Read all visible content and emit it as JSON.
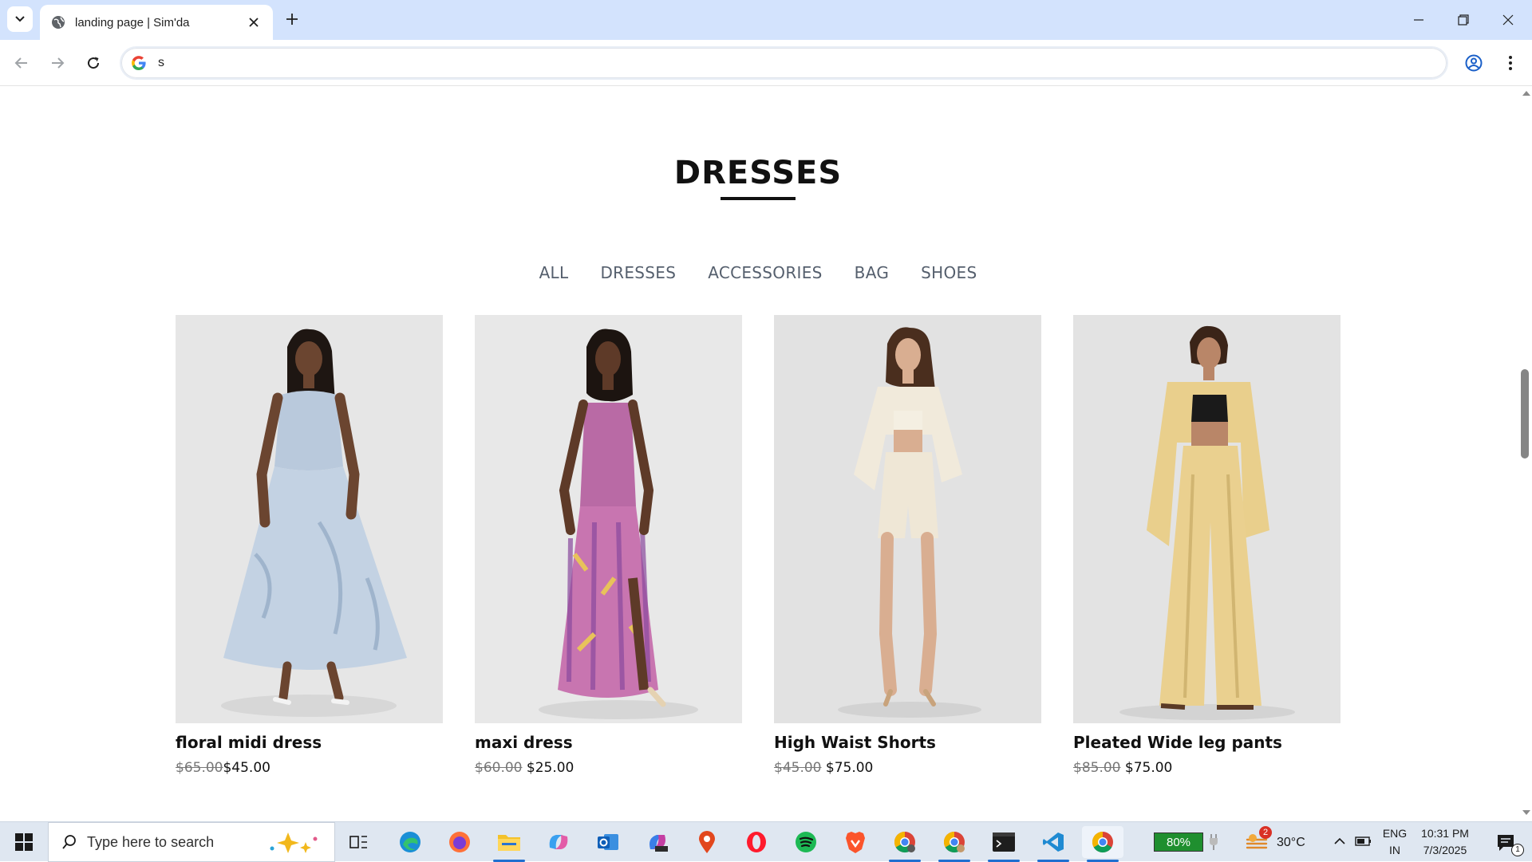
{
  "browser": {
    "tab_title": "landing page | Sim'da",
    "address_value": "s",
    "address_placeholder": ""
  },
  "page": {
    "section_title": "DRESSES",
    "filters": [
      "ALL",
      "DRESSES",
      "ACCESSORIES",
      "BAG",
      "SHOES"
    ],
    "products": [
      {
        "name": "floral midi dress",
        "old_price": "$65.00",
        "price": "$45.00"
      },
      {
        "name": "maxi dress",
        "old_price": "$60.00",
        "price": "$25.00"
      },
      {
        "name": "High Waist Shorts",
        "old_price": "$45.00",
        "price": "$75.00"
      },
      {
        "name": "Pleated Wide leg pants",
        "old_price": "$85.00",
        "price": "$75.00"
      }
    ]
  },
  "taskbar": {
    "search_placeholder": "Type here to search",
    "battery": "80%",
    "weather_badge": "2",
    "temperature": "30°C",
    "lang_line1": "ENG",
    "lang_line2": "IN",
    "time": "10:31 PM",
    "date": "7/3/2025",
    "notification_count": "1"
  },
  "colors": {
    "tabstrip": "#d3e3fd",
    "accent_blue": "#1f6fd0",
    "battery_green": "#1f8f2f"
  }
}
